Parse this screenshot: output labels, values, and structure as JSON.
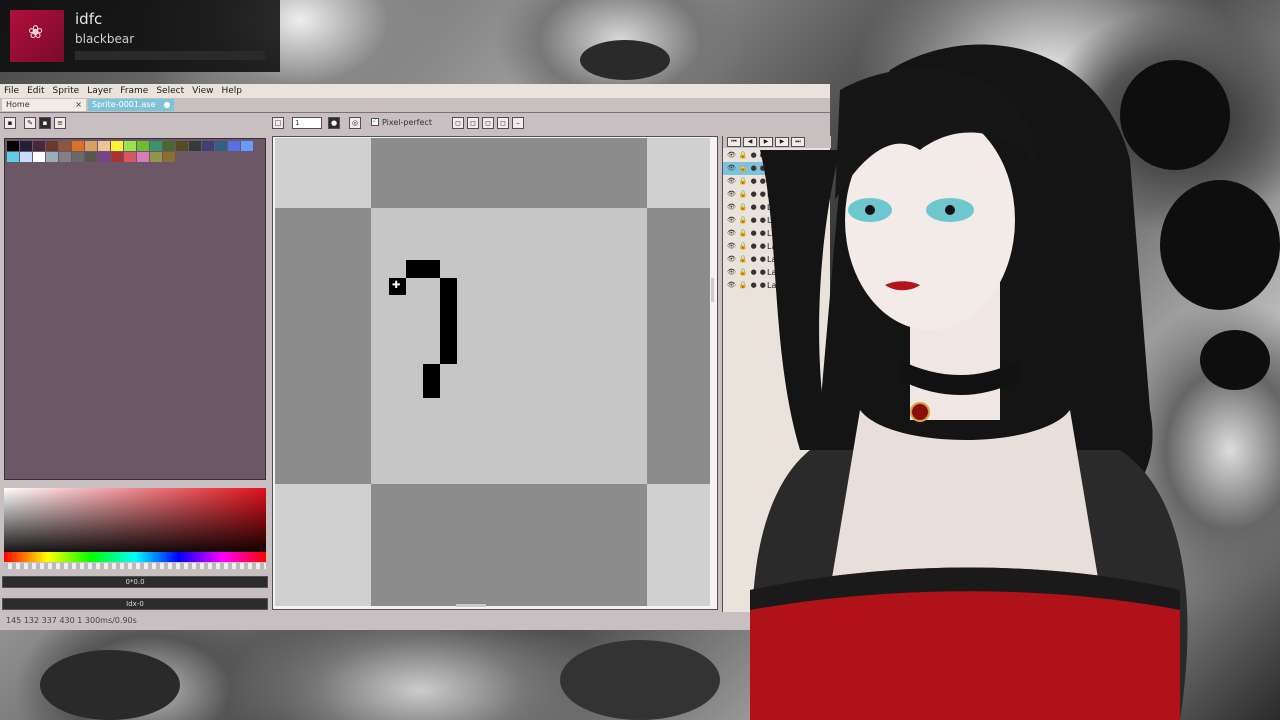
{
  "now_playing": {
    "title": "idfc",
    "artist": "blackbear",
    "progress": 0.0,
    "art_icon": "rose-icon"
  },
  "menu": [
    "File",
    "Edit",
    "Sprite",
    "Layer",
    "Frame",
    "Select",
    "View",
    "Help"
  ],
  "tabs": [
    {
      "label": "Home",
      "active": false
    },
    {
      "label": "Sprite-0001.ase",
      "active": true
    }
  ],
  "toolbar": {
    "zoom_value": "1",
    "pixel_perfect_label": "Pixel-perfect",
    "pixel_perfect_checked": true
  },
  "palette": {
    "colors_row1": [
      "#000000",
      "#222034",
      "#45283c",
      "#663931",
      "#8f563b",
      "#df7126",
      "#d9a066",
      "#eec39a",
      "#fbf236",
      "#99e550",
      "#6abe30",
      "#37946e",
      "#4b692f",
      "#524b24",
      "#323c39",
      "#3f3f74",
      "#306082",
      "#5b6ee1",
      "#639bff"
    ],
    "colors_row2": [
      "#5fcde4",
      "#cbdbfc",
      "#ffffff",
      "#9badb7",
      "#847e87",
      "#696a6a",
      "#595652",
      "#76428a",
      "#ac3232",
      "#d95763",
      "#d77bba",
      "#8f974a",
      "#8a6f30"
    ]
  },
  "color_fields": {
    "hex_label": "0*0.0",
    "index_label": "Idx-0"
  },
  "layers": [
    "Layer 11",
    "Layer 10",
    "Layer 9",
    "Layer 8",
    "Layer 7",
    "Layer 6",
    "Layer 5",
    "Layer 4",
    "Layer 2",
    "Layer 1"
  ],
  "selected_layer": "Layer 11",
  "status": {
    "text": "145 132   337 430   1   300ms/0.90s"
  },
  "colors": {
    "accent": "#7ec3d9",
    "window_bg": "#c8bfc0",
    "palette_panel": "#6b5765"
  }
}
